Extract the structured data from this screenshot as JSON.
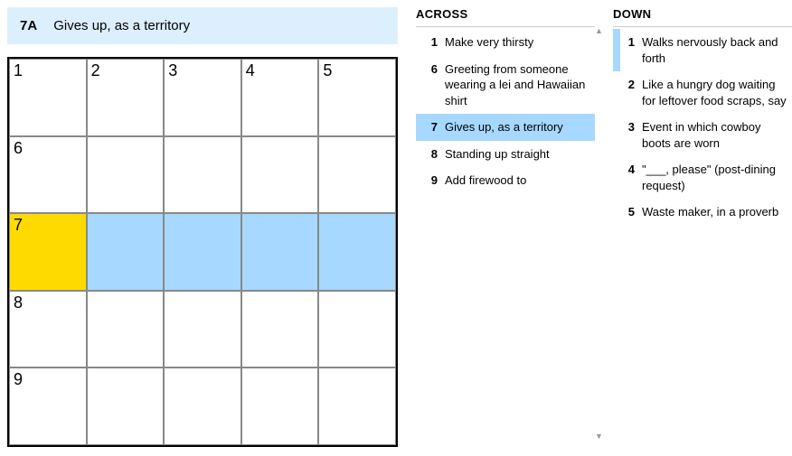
{
  "current_clue": {
    "label": "7A",
    "text": "Gives up, as a territory"
  },
  "grid": {
    "rows": 5,
    "cols": 5,
    "cells": [
      [
        {
          "n": "1"
        },
        {
          "n": "2"
        },
        {
          "n": "3"
        },
        {
          "n": "4"
        },
        {
          "n": "5"
        }
      ],
      [
        {
          "n": "6"
        },
        {},
        {},
        {},
        {}
      ],
      [
        {
          "n": "7",
          "state": "focus"
        },
        {
          "state": "highlight"
        },
        {
          "state": "highlight"
        },
        {
          "state": "highlight"
        },
        {
          "state": "highlight"
        }
      ],
      [
        {
          "n": "8"
        },
        {},
        {},
        {},
        {}
      ],
      [
        {
          "n": "9"
        },
        {},
        {},
        {},
        {}
      ]
    ]
  },
  "across": {
    "header": "ACROSS",
    "clues": [
      {
        "n": "1",
        "t": "Make very thirsty"
      },
      {
        "n": "6",
        "t": "Greeting from someone wearing a lei and Hawaiian shirt"
      },
      {
        "n": "7",
        "t": "Gives up, as a territory",
        "selected": true
      },
      {
        "n": "8",
        "t": "Standing up straight"
      },
      {
        "n": "9",
        "t": "Add firewood to"
      }
    ]
  },
  "down": {
    "header": "DOWN",
    "clues": [
      {
        "n": "1",
        "t": "Walks nervously back and forth",
        "related": true
      },
      {
        "n": "2",
        "t": "Like a hungry dog waiting for leftover food scraps, say"
      },
      {
        "n": "3",
        "t": "Event in which cowboy boots are worn"
      },
      {
        "n": "4",
        "t": "\"___, please\" (post-dining request)"
      },
      {
        "n": "5",
        "t": "Waste maker, in a proverb"
      }
    ]
  },
  "colors": {
    "highlight": "#a7d8ff",
    "focus": "#ffda00",
    "cluebar": "#dcefff"
  }
}
